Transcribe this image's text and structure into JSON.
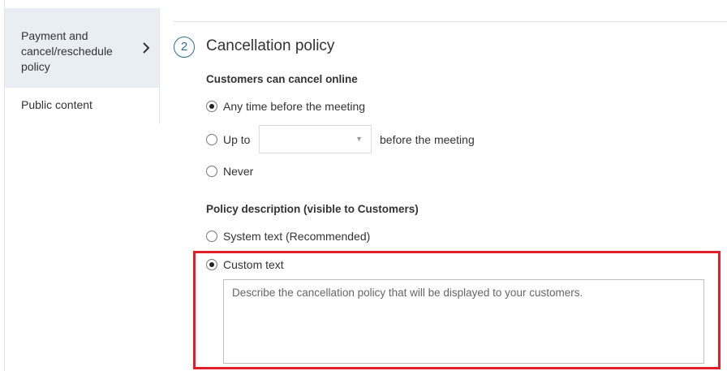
{
  "sidebar": {
    "items": [
      {
        "label": "Payment and cancel/reschedule policy",
        "active": true
      },
      {
        "label": "Public content",
        "active": false
      }
    ]
  },
  "section": {
    "step_number": "2",
    "title": "Cancellation policy"
  },
  "cancel_online": {
    "heading": "Customers can cancel online",
    "options": [
      {
        "label": "Any time before the meeting",
        "selected": true
      },
      {
        "label_before": "Up to",
        "select_value": "",
        "label_after": "before the meeting",
        "selected": false
      },
      {
        "label": "Never",
        "selected": false
      }
    ]
  },
  "policy_description": {
    "heading": "Policy description (visible to Customers)",
    "options": [
      {
        "label": "System text (Recommended)",
        "selected": false
      },
      {
        "label": "Custom text",
        "selected": true
      }
    ],
    "textarea": {
      "value": "",
      "placeholder": "Describe the cancellation policy that will be displayed to your customers."
    }
  },
  "colors": {
    "highlight_border": "#e01f2b",
    "step_accent": "#2a6f99",
    "sidebar_active_bg": "#e8eef3"
  },
  "icons": {
    "sidebar_chevron": "chevron-right-icon",
    "select_arrow": "caret-down-icon"
  }
}
